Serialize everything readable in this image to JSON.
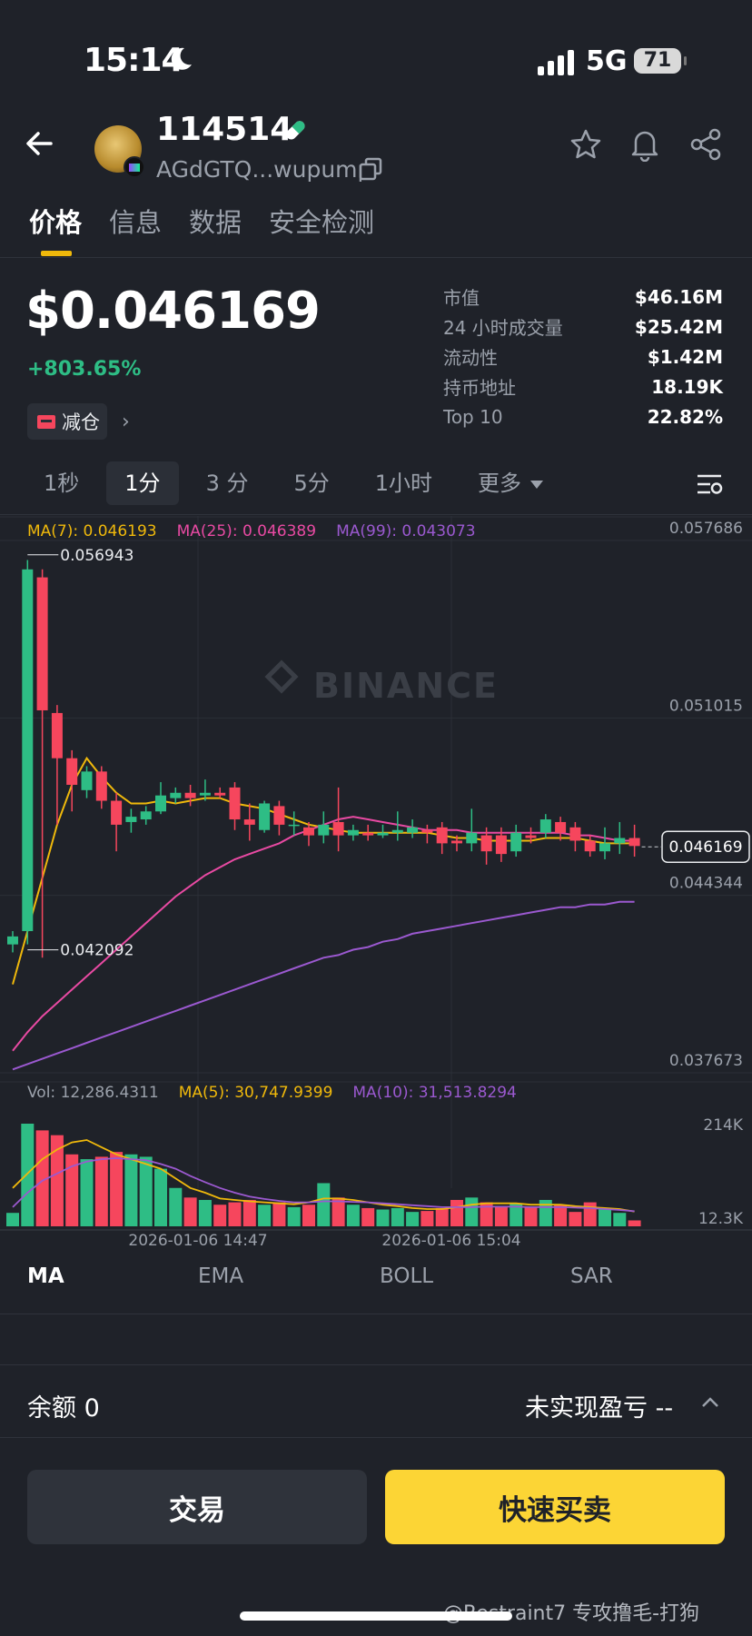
{
  "status_bar": {
    "time": "15:14",
    "network": "5G",
    "battery": "71"
  },
  "header": {
    "token_name": "114514",
    "token_address": "AGdGTQ...wupump"
  },
  "tabs": [
    "价格",
    "信息",
    "数据",
    "安全检测"
  ],
  "price": {
    "value": "$0.046169",
    "change": "+803.65%",
    "reduce_label": "减仓"
  },
  "stats": [
    {
      "label": "市值",
      "value": "$46.16M"
    },
    {
      "label": "24 小时成交量",
      "value": "$25.42M"
    },
    {
      "label": "流动性",
      "value": "$1.42M"
    },
    {
      "label": "持币地址",
      "value": "18.19K"
    },
    {
      "label": "Top 10",
      "value": "22.82%"
    }
  ],
  "intervals": [
    "1秒",
    "1分",
    "3 分",
    "5分",
    "1小时",
    "更多"
  ],
  "active_interval": "1分",
  "chart_legend": {
    "ma7": "MA(7): 0.046193",
    "ma25": "MA(25): 0.046389",
    "ma99": "MA(99): 0.043073",
    "vol": "Vol: 12,286.4311",
    "vol_ma5": "MA(5): 30,747.9399",
    "vol_ma10": "MA(10): 31,513.8294"
  },
  "chart_data": {
    "type": "candlestick",
    "y_ticks": [
      "0.057686",
      "0.051015",
      "0.044344",
      "0.037673"
    ],
    "ylim": [
      0.037673,
      0.057686
    ],
    "high_label": "0.056943",
    "low_label": "0.042092",
    "current_price_label": "0.046169",
    "x_ticks": [
      "2026-01-06 14:47",
      "2026-01-06 15:04"
    ],
    "watermark": "BINANCE",
    "candles": [
      [
        0.0425,
        0.0428,
        0.0422,
        0.043
      ],
      [
        0.043,
        0.0566,
        0.0425,
        0.05695
      ],
      [
        0.0563,
        0.0513,
        0.042,
        0.0566
      ],
      [
        0.0512,
        0.0495,
        0.047,
        0.0515
      ],
      [
        0.0495,
        0.0485,
        0.0475,
        0.0498
      ],
      [
        0.0483,
        0.049,
        0.048,
        0.0492
      ],
      [
        0.049,
        0.0479,
        0.0476,
        0.0492
      ],
      [
        0.0479,
        0.047,
        0.046,
        0.0482
      ],
      [
        0.0471,
        0.0473,
        0.0467,
        0.0476
      ],
      [
        0.0472,
        0.0475,
        0.047,
        0.0477
      ],
      [
        0.0475,
        0.0481,
        0.0474,
        0.0486
      ],
      [
        0.048,
        0.0482,
        0.0478,
        0.0484
      ],
      [
        0.0482,
        0.048,
        0.0477,
        0.0485
      ],
      [
        0.0481,
        0.0482,
        0.0479,
        0.0487
      ],
      [
        0.0482,
        0.0481,
        0.048,
        0.0484
      ],
      [
        0.0484,
        0.0472,
        0.0468,
        0.0486
      ],
      [
        0.0472,
        0.047,
        0.0464,
        0.0478
      ],
      [
        0.0468,
        0.0478,
        0.0467,
        0.0479
      ],
      [
        0.0477,
        0.047,
        0.0466,
        0.0479
      ],
      [
        0.047,
        0.047,
        0.0466,
        0.0475
      ],
      [
        0.0469,
        0.0466,
        0.0462,
        0.0471
      ],
      [
        0.0466,
        0.047,
        0.0463,
        0.0475
      ],
      [
        0.0471,
        0.0466,
        0.046,
        0.0484
      ],
      [
        0.0466,
        0.0468,
        0.0464,
        0.047
      ],
      [
        0.0467,
        0.0466,
        0.0464,
        0.047
      ],
      [
        0.0466,
        0.0467,
        0.0465,
        0.047
      ],
      [
        0.0467,
        0.0468,
        0.0464,
        0.0475
      ],
      [
        0.0467,
        0.0469,
        0.0465,
        0.0472
      ],
      [
        0.0468,
        0.0467,
        0.0463,
        0.047
      ],
      [
        0.0469,
        0.0463,
        0.0459,
        0.0471
      ],
      [
        0.0464,
        0.0463,
        0.046,
        0.0466
      ],
      [
        0.0463,
        0.0467,
        0.046,
        0.0476
      ],
      [
        0.0466,
        0.046,
        0.0455,
        0.0469
      ],
      [
        0.0466,
        0.0459,
        0.0456,
        0.0469
      ],
      [
        0.046,
        0.0467,
        0.0458,
        0.047
      ],
      [
        0.0466,
        0.0465,
        0.0463,
        0.0469
      ],
      [
        0.0467,
        0.0472,
        0.0465,
        0.0474
      ],
      [
        0.0471,
        0.0467,
        0.0464,
        0.0473
      ],
      [
        0.0469,
        0.0464,
        0.046,
        0.0471
      ],
      [
        0.0464,
        0.046,
        0.0458,
        0.0466
      ],
      [
        0.046,
        0.0463,
        0.0457,
        0.0469
      ],
      [
        0.0463,
        0.0465,
        0.0459,
        0.0471
      ],
      [
        0.0465,
        0.0462,
        0.0458,
        0.047
      ]
    ],
    "ma_series": [
      {
        "name": "MA(7)",
        "color": "#f0b90b",
        "values": [
          0.041,
          0.043,
          0.045,
          0.047,
          0.0485,
          0.0495,
          0.0488,
          0.0482,
          0.0478,
          0.0478,
          0.0479,
          0.0478,
          0.0479,
          0.048,
          0.048,
          0.0478,
          0.0477,
          0.0476,
          0.0474,
          0.0472,
          0.047,
          0.0469,
          0.0468,
          0.0467,
          0.0467,
          0.0467,
          0.0467,
          0.0467,
          0.0467,
          0.0466,
          0.0465,
          0.0465,
          0.0464,
          0.0464,
          0.0464,
          0.0464,
          0.0465,
          0.0465,
          0.0465,
          0.0464,
          0.0463,
          0.0463,
          0.0463
        ]
      },
      {
        "name": "MA(25)",
        "color": "#e94aa3",
        "values": [
          0.0385,
          0.0392,
          0.0398,
          0.0403,
          0.0408,
          0.0413,
          0.0418,
          0.0423,
          0.0428,
          0.0433,
          0.0438,
          0.0443,
          0.0447,
          0.0451,
          0.0454,
          0.0457,
          0.0459,
          0.0461,
          0.0463,
          0.0466,
          0.0468,
          0.047,
          0.0472,
          0.0473,
          0.0472,
          0.0471,
          0.047,
          0.0469,
          0.0468,
          0.0468,
          0.0468,
          0.0467,
          0.0467,
          0.0467,
          0.0467,
          0.0467,
          0.0467,
          0.0467,
          0.0466,
          0.0466,
          0.0465,
          0.0464,
          0.0464
        ]
      },
      {
        "name": "MA(99)",
        "color": "#9b59d0",
        "values": [
          0.0378,
          0.038,
          0.0382,
          0.0384,
          0.0386,
          0.0388,
          0.039,
          0.0392,
          0.0394,
          0.0396,
          0.0398,
          0.04,
          0.0402,
          0.0404,
          0.0406,
          0.0408,
          0.041,
          0.0412,
          0.0414,
          0.0416,
          0.0418,
          0.042,
          0.0421,
          0.0423,
          0.0424,
          0.0426,
          0.0427,
          0.0429,
          0.043,
          0.0431,
          0.0432,
          0.0433,
          0.0434,
          0.0435,
          0.0436,
          0.0437,
          0.0438,
          0.0439,
          0.0439,
          0.044,
          0.044,
          0.0441,
          0.0441
        ]
      }
    ],
    "volume": {
      "y_ticks": [
        "214K",
        "12.3K"
      ],
      "ymax": 214000,
      "values": [
        28000,
        214000,
        200000,
        190000,
        150000,
        140000,
        145000,
        155000,
        150000,
        145000,
        120000,
        80000,
        60000,
        55000,
        45000,
        50000,
        55000,
        45000,
        50000,
        40000,
        45000,
        90000,
        60000,
        45000,
        38000,
        35000,
        38000,
        30000,
        32000,
        38000,
        55000,
        60000,
        50000,
        42000,
        48000,
        40000,
        55000,
        45000,
        30000,
        50000,
        35000,
        28000,
        12300
      ],
      "ma5": [
        80000,
        110000,
        140000,
        160000,
        175000,
        180000,
        165000,
        150000,
        140000,
        130000,
        120000,
        100000,
        80000,
        70000,
        58000,
        55000,
        52000,
        50000,
        48000,
        46000,
        50000,
        58000,
        58000,
        55000,
        50000,
        45000,
        42000,
        38000,
        36000,
        36000,
        40000,
        45000,
        48000,
        48000,
        48000,
        45000,
        45000,
        45000,
        42000,
        40000,
        38000,
        36000,
        30747
      ],
      "ma10": [
        40000,
        70000,
        95000,
        110000,
        125000,
        135000,
        140000,
        142000,
        140000,
        138000,
        130000,
        120000,
        105000,
        92000,
        80000,
        70000,
        62000,
        57000,
        53000,
        50000,
        50000,
        52000,
        52000,
        51000,
        50000,
        48000,
        46000,
        44000,
        42000,
        40000,
        40000,
        40000,
        41000,
        41000,
        41000,
        40000,
        40000,
        40000,
        39000,
        38000,
        36000,
        34000,
        31513
      ]
    }
  },
  "indicator_tabs": [
    "MA",
    "EMA",
    "BOLL",
    "SAR"
  ],
  "bottom": {
    "balance": "余额 0",
    "pnl": "未实现盈亏 --",
    "trade_label": "交易",
    "quick_label": "快速买卖"
  },
  "watermark_footer": "@Restraint7 专攻撸毛-打狗"
}
